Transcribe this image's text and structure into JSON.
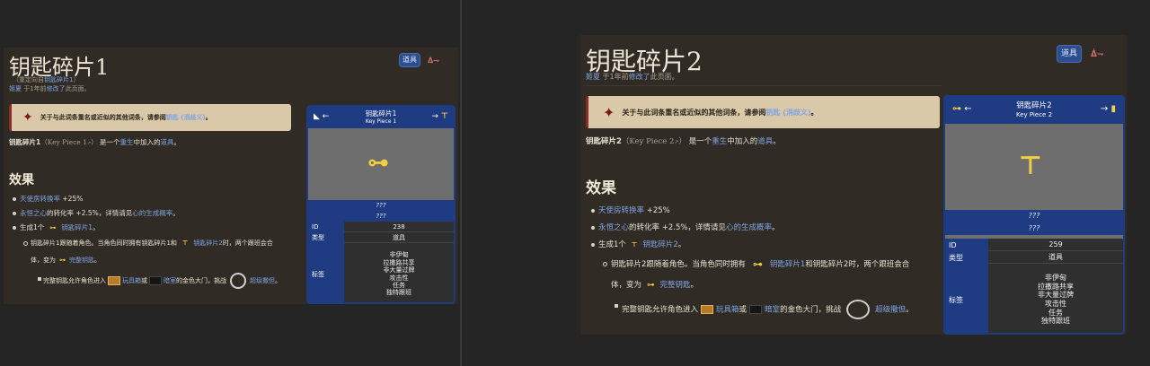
{
  "left": {
    "title": "钥匙碎片1",
    "redirect_pre": "（重定向自",
    "redirect_link": "钥匙碎片1",
    "redirect_post": "）",
    "editor": "姬夏",
    "edit_mid": " 于1年前",
    "edit_link": "修改了",
    "edit_post": "此页面。",
    "tab_label": "道具",
    "tools_label": "ᐄ⇁",
    "note_text": "关于与此词条重名或近似的其他词条，请参阅",
    "note_link": "钥匙 (消歧义)",
    "note_end": "。",
    "intro_name": "钥匙碎片1",
    "intro_paren": "（Key Piece 1",
    "intro_paren_end": "）",
    "intro_mid": "是一个",
    "intro_link1": "重生",
    "intro_mid2": "中加入的",
    "intro_link2": "道具",
    "intro_end": "。",
    "effects_heading": "效果",
    "b1_link": "天使房转换率",
    "b1_text": " +25%",
    "b2_link": "永恒之心",
    "b2_text": "的转化率 +2.5%，详情请见",
    "b2_link2": "心的生成概率",
    "b2_end": "。",
    "b3_text": "生成1个",
    "b3_link": "钥匙碎片1",
    "b3_end": "。",
    "s1_text": "钥匙碎片1跟随着角色。当角色同时拥有钥匙碎片1和",
    "s1_link": "钥匙碎片2",
    "s1_text2": "时，两个跟班会合",
    "s1_line2": "体，变为",
    "s1_link2": "完整钥匙",
    "s1_end": "。",
    "t1_text": "完整钥匙允许角色进入",
    "t1_link": "玩具箱",
    "t1_mid": "或",
    "t1_link2": "暗室",
    "t1_text2": "的金色大门，挑战",
    "t1_link3": "超级撒但",
    "t1_end": "。",
    "ib_name": "钥匙碎片1",
    "ib_en": "Key Piece 1",
    "ib_arrow_l": "←",
    "ib_arrow_r": "→",
    "ib_q1": "???",
    "ib_q2": "???",
    "ib_id_label": "ID",
    "ib_id": "238",
    "ib_type_label": "类型",
    "ib_type": "道具",
    "ib_tag_label": "标签",
    "ib_tags": [
      "非伊甸",
      "拉撒路共享",
      "非大量过牌",
      "攻击性",
      "任务",
      "独特跟班"
    ]
  },
  "right": {
    "title": "钥匙碎片2",
    "editor": "姬夏",
    "edit_mid": " 于1年前",
    "edit_link": "修改了",
    "edit_post": "此页面。",
    "tab_label": "道具",
    "tools_label": "ᐄ⇁",
    "note_text": "关于与此词条重名或近似的其他词条，请参阅",
    "note_link": "钥匙 (消歧义)",
    "note_end": "。",
    "intro_name": "钥匙碎片2",
    "intro_paren": "（Key Piece 2",
    "intro_paren_end": "）",
    "intro_mid": "是一个",
    "intro_link1": "重生",
    "intro_mid2": "中加入的",
    "intro_link2": "道具",
    "intro_end": "。",
    "effects_heading": "效果",
    "b1_link": "天使房转换率",
    "b1_text": " +25%",
    "b2_link": "永恒之心",
    "b2_text": "的转化率 +2.5%，详情请见",
    "b2_link2": "心的生成概率",
    "b2_end": "。",
    "b3_text": "生成1个",
    "b3_link": "钥匙碎片2",
    "b3_end": "。",
    "s1_text": "钥匙碎片2跟随着角色。当角色同时拥有",
    "s1_link": "钥匙碎片1",
    "s1_text2": "和钥匙碎片2时，两个跟班会合",
    "s1_line2": "体，变为",
    "s1_link2": "完整钥匙",
    "s1_end": "。",
    "t1_text": "完整钥匙允许角色进入",
    "t1_link": "玩具箱",
    "t1_mid": "或",
    "t1_link2": "暗室",
    "t1_text2": "的金色大门，挑战",
    "t1_link3": "超级撒但",
    "t1_end": "。",
    "ib_name": "钥匙碎片2",
    "ib_en": "Key Piece 2",
    "ib_arrow_l": "←",
    "ib_arrow_r": "→",
    "ib_q1": "???",
    "ib_q2": "???",
    "ib_id_label": "ID",
    "ib_id": "259",
    "ib_type_label": "类型",
    "ib_type": "道具",
    "ib_tag_label": "标签",
    "ib_tags": [
      "非伊甸",
      "拉撒路共享",
      "非大量过牌",
      "攻击性",
      "任务",
      "独特跟班"
    ]
  }
}
